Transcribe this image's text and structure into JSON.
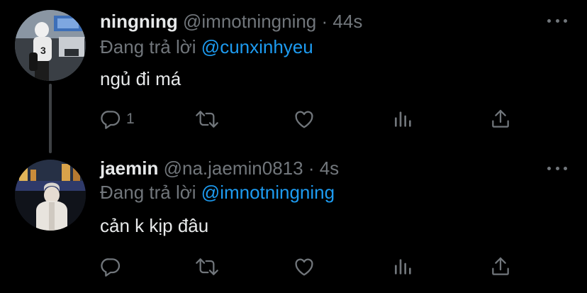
{
  "tweets": [
    {
      "author": {
        "display_name": "ningning",
        "handle": "@imnotningning",
        "avatar_icon": "user-avatar-photo"
      },
      "separator": "·",
      "time": "44s",
      "reply_label": "Đang trả lời",
      "reply_to": "@cunxinhyeu",
      "text": "ngủ đi má",
      "actions": {
        "reply_count": "1",
        "retweet_count": "",
        "like_count": ""
      }
    },
    {
      "author": {
        "display_name": "jaemin",
        "handle": "@na.jaemin0813",
        "avatar_icon": "user-avatar-photo"
      },
      "separator": "·",
      "time": "4s",
      "reply_label": "Đang trả lời",
      "reply_to": "@imnotningning",
      "text": "cản k kịp đâu",
      "actions": {
        "reply_count": "",
        "retweet_count": "",
        "like_count": ""
      }
    }
  ],
  "colors": {
    "background": "#000000",
    "primary_text": "#e7e9ea",
    "secondary_text": "#71767b",
    "link": "#1d9bf0",
    "thread_line": "#3e4144"
  }
}
